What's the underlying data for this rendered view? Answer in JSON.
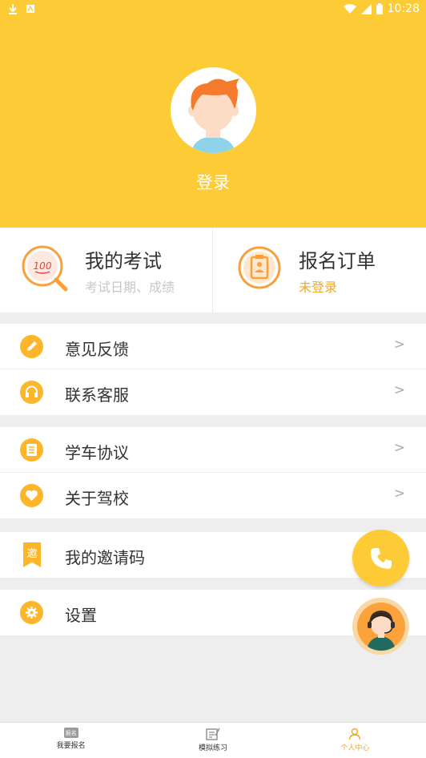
{
  "status_bar": {
    "time": "10:28"
  },
  "profile": {
    "login_label": "登录"
  },
  "cards": [
    {
      "title": "我的考试",
      "subtitle": "考试日期、成绩",
      "icon": "exam-score-icon"
    },
    {
      "title": "报名订单",
      "subtitle": "未登录",
      "icon": "registration-order-icon"
    }
  ],
  "menu": {
    "feedback": "意见反馈",
    "customer_service": "联系客服",
    "agreement": "学车协议",
    "about_school": "关于驾校",
    "invite_code": "我的邀请码",
    "invite_badge": "邀",
    "settings": "设置",
    "arrow": ">"
  },
  "bottom_nav": [
    {
      "label": "我要报名",
      "icon": "registration-icon",
      "badge": "报名"
    },
    {
      "label": "模拟练习",
      "icon": "practice-icon"
    },
    {
      "label": "个人中心",
      "icon": "profile-icon",
      "active": true
    }
  ],
  "colors": {
    "brand": "#fdcb36",
    "accent": "#fdb52a",
    "active_nav": "#f7a623"
  }
}
